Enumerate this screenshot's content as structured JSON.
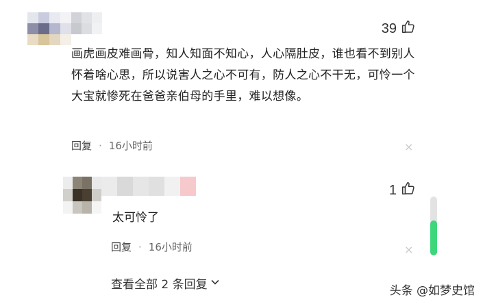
{
  "colors": {
    "accent_green": "#3dd67a",
    "text_primary": "#222222",
    "text_meta": "#555555"
  },
  "comment": {
    "like_count": "39",
    "text": "画虎画皮难画骨，知人知面不知心，人心隔肚皮，谁也看不到别人怀着啥心思，所以说害人之心不可有，防人之心不干无，可怜一个大宝就惨死在爸爸亲伯母的手里，难以想像。",
    "reply_label": "回复",
    "separator": "·",
    "time": "16小时前",
    "close_icon": "×"
  },
  "reply": {
    "like_count": "1",
    "text": "太可怜了",
    "reply_label": "回复",
    "separator": "·",
    "time": "16小时前",
    "close_icon": "×"
  },
  "view_all_label": "查看全部 2 条回复",
  "watermark": "头条 @如梦史馆",
  "icons": {
    "like": "thumbs-up-icon",
    "close": "close-icon",
    "chevron": "chevron-down-icon"
  }
}
